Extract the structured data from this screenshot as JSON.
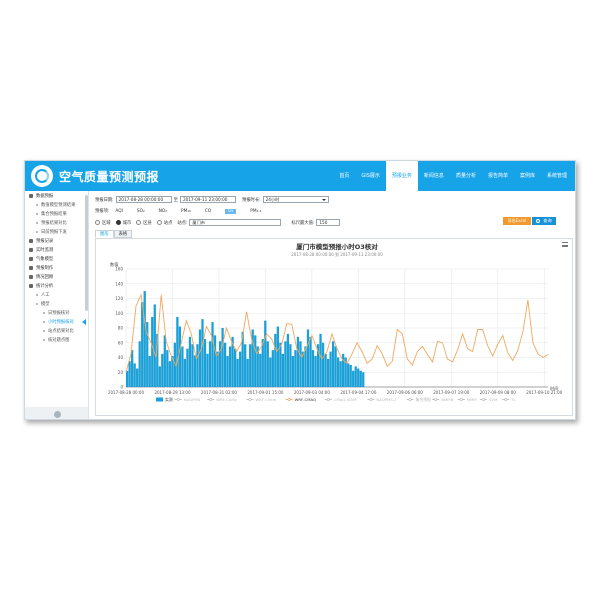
{
  "app": {
    "title": "空气质量预测预报"
  },
  "nav": [
    "首页",
    "GIS展示",
    "预报业务",
    "新闻信息",
    "质量分析",
    "报告简单",
    "案例库",
    "系统管理"
  ],
  "nav_active": 2,
  "sidebar": {
    "items": [
      {
        "label": "数据预报",
        "level": 0
      },
      {
        "label": "数值模型预测结果",
        "level": 1
      },
      {
        "label": "集合预报结果",
        "level": 1
      },
      {
        "label": "预报结果对比",
        "level": 1
      },
      {
        "label": "日前预报下发",
        "level": 1
      },
      {
        "label": "预报记录",
        "level": 0
      },
      {
        "label": "实时监测",
        "level": 0
      },
      {
        "label": "气象模型",
        "level": 0
      },
      {
        "label": "预报制作",
        "level": 0
      },
      {
        "label": "情况回顾",
        "level": 0
      },
      {
        "label": "统计分析",
        "level": 0
      },
      {
        "label": "人工",
        "level": 1
      },
      {
        "label": "模型",
        "level": 1
      },
      {
        "label": "日预报核对",
        "level": 2
      },
      {
        "label": "小时预报核对",
        "level": 2,
        "active": true
      },
      {
        "label": "站点结果对比",
        "level": 2
      },
      {
        "label": "核对题点图",
        "level": 2
      }
    ]
  },
  "filters": {
    "start_label": "预报日期:",
    "start_value": "2017-08-28 00:00:00",
    "to_label": "至",
    "end_value": "2017-09-11 23:00:00",
    "period_label": "预报时长:",
    "period_value": "24小时",
    "pollutant_label": "预报项:",
    "pollutants": [
      "AQI",
      "SO₂",
      "NO₂",
      "PM₁₀",
      "CO",
      "O₃",
      "PM₂.₅"
    ],
    "pollutant_active": 5,
    "scope_options": [
      "区域",
      "城市",
      "区县",
      "站点"
    ],
    "scope_active": 1,
    "area_label": "站点:",
    "area_value": "厦门市",
    "max_label": "标尺最大值:",
    "max_value": "150",
    "export_label": "导出Excel",
    "query_label": "查询"
  },
  "tabs": [
    "图形",
    "表格"
  ],
  "tab_active": 0,
  "chart_data": {
    "type": "line",
    "title": "厦门市模型预报小时O3核对",
    "subtitle": "2017-08-28 00:00:00 到 2017-09-11 23:00:00",
    "ylabel": "数值",
    "xlabel": "时间",
    "ylim": [
      0,
      160
    ],
    "yticks": [
      0,
      20,
      40,
      60,
      80,
      100,
      120,
      140,
      160
    ],
    "xlim": [
      0,
      336
    ],
    "x_tick_labels": [
      {
        "h": 0,
        "label": "2017-08-28 00:00"
      },
      {
        "h": 37,
        "label": "2017-08-29 13:00"
      },
      {
        "h": 74,
        "label": "2017-08-31 02:00"
      },
      {
        "h": 111,
        "label": "2017-09-01 15:00"
      },
      {
        "h": 148,
        "label": "2017-09-03 04:00"
      },
      {
        "h": 185,
        "label": "2017-09-04 17:00"
      },
      {
        "h": 222,
        "label": "2017-09-06 06:00"
      },
      {
        "h": 259,
        "label": "2017-09-07 19:00"
      },
      {
        "h": 296,
        "label": "2017-09-09 08:00"
      },
      {
        "h": 333,
        "label": "2017-09-10 21:00"
      }
    ],
    "measured": {
      "name": "实测",
      "color": "#1a9fd6",
      "start_h": 0,
      "step_h": 2,
      "values": [
        22,
        35,
        50,
        32,
        25,
        62,
        115,
        130,
        88,
        42,
        95,
        112,
        72,
        28,
        45,
        70,
        50,
        35,
        42,
        60,
        95,
        82,
        55,
        38,
        52,
        68,
        58,
        43,
        58,
        78,
        92,
        65,
        45,
        62,
        88,
        70,
        48,
        62,
        80,
        60,
        42,
        55,
        68,
        52,
        38,
        48,
        75,
        58,
        38,
        58,
        78,
        70,
        55,
        45,
        65,
        90,
        62,
        40,
        50,
        72,
        82,
        60,
        45,
        62,
        72,
        58,
        42,
        50,
        68,
        62,
        48,
        55,
        78,
        68,
        50,
        42,
        58,
        72,
        60,
        45,
        38,
        48,
        62,
        55,
        40,
        35,
        45,
        40,
        32,
        30,
        22,
        28,
        25,
        22,
        20
      ]
    },
    "forecast": {
      "name": "WRF-CMAQ",
      "color": "#f0a860",
      "start_h": 0,
      "step_h": 4,
      "values": [
        20,
        45,
        110,
        125,
        75,
        60,
        40,
        125,
        62,
        42,
        28,
        60,
        90,
        72,
        38,
        52,
        82,
        70,
        42,
        52,
        80,
        62,
        48,
        60,
        102,
        65,
        45,
        55,
        72,
        65,
        48,
        58,
        86,
        85,
        52,
        40,
        55,
        70,
        52,
        38,
        48,
        72,
        52,
        38,
        32,
        45,
        60,
        48,
        32,
        38,
        56,
        45,
        28,
        35,
        78,
        72,
        38,
        30,
        48,
        55,
        44,
        34,
        62,
        60,
        38,
        34,
        50,
        72,
        52,
        48,
        78,
        78,
        56,
        42,
        58,
        70,
        46,
        36,
        50,
        75,
        118,
        60,
        45,
        40,
        44
      ]
    },
    "legend": [
      {
        "name": "实测",
        "color": "#1a9fd6",
        "enabled": true
      },
      {
        "name": "NAQPMS",
        "color": "#bbbbbb",
        "enabled": false
      },
      {
        "name": "WRF-CAMx",
        "color": "#bbbbbb",
        "enabled": false
      },
      {
        "name": "WRF-Chem",
        "color": "#bbbbbb",
        "enabled": false
      },
      {
        "name": "WRF-CMAQ",
        "color": "#f0a860",
        "enabled": true
      },
      {
        "name": "CMAQ-ISAM",
        "color": "#bbbbbb",
        "enabled": false
      },
      {
        "name": "NAQPMS-2",
        "color": "#bbbbbb",
        "enabled": false
      },
      {
        "name": "集合预报",
        "color": "#bbbbbb",
        "enabled": false
      },
      {
        "name": "NMMB",
        "color": "#bbbbbb",
        "enabled": false
      },
      {
        "name": "MMM",
        "color": "#bbbbbb",
        "enabled": false
      },
      {
        "name": "SVM",
        "color": "#bbbbbb",
        "enabled": false
      },
      {
        "name": "TL",
        "color": "#bbbbbb",
        "enabled": false
      }
    ]
  }
}
